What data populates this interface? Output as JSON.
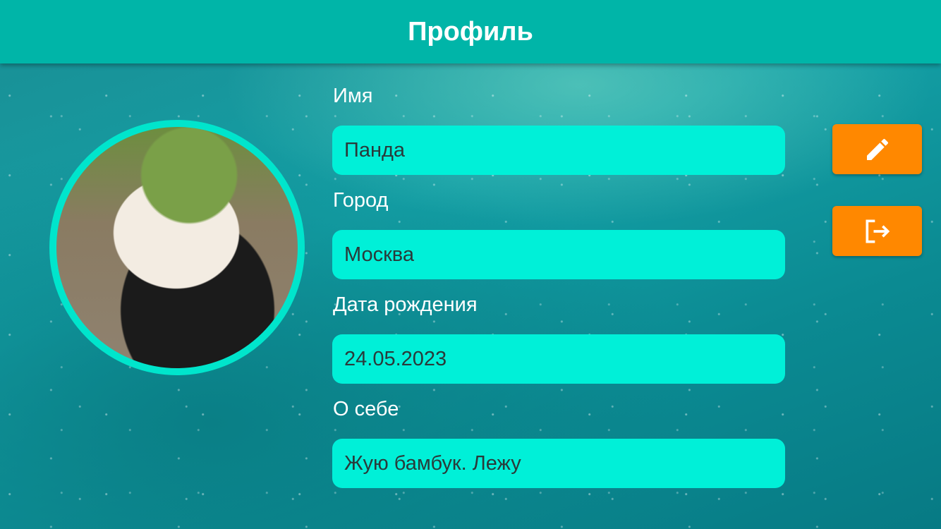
{
  "header": {
    "title": "Профиль"
  },
  "fields": [
    {
      "label": "Имя",
      "value": "Панда"
    },
    {
      "label": "Город",
      "value": "Москва"
    },
    {
      "label": "Дата рождения",
      "value": "24.05.2023"
    },
    {
      "label": "О себе",
      "value": "Жую бамбук. Лежу"
    }
  ],
  "buttons": {
    "edit": "edit-icon",
    "logout": "logout-icon"
  },
  "colors": {
    "header": "#00b5a8",
    "field": "#00f0d8",
    "button": "#ff8800"
  }
}
